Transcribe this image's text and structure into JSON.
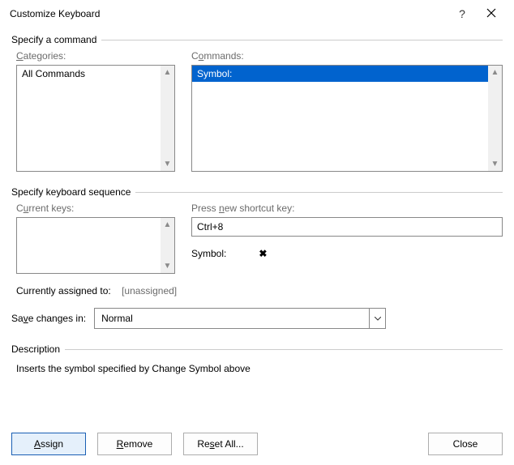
{
  "title": "Customize Keyboard",
  "sections": {
    "specify_command": "Specify a command",
    "specify_sequence": "Specify keyboard sequence",
    "description": "Description"
  },
  "categories": {
    "label": "Categories:",
    "label_access": "C",
    "selected": "All Commands"
  },
  "commands": {
    "label": "Commands:",
    "label_access": "o",
    "selected": "Symbol:"
  },
  "current_keys": {
    "label": "Current keys:",
    "label_access": "u"
  },
  "new_key": {
    "label": "Press new shortcut key:",
    "label_access": "n",
    "value": "Ctrl+8"
  },
  "symbol": {
    "label": "Symbol:",
    "glyph": "✖"
  },
  "assigned": {
    "label": "Currently assigned to:",
    "value": "[unassigned]"
  },
  "save": {
    "label": "Save changes in:",
    "label_access": "v",
    "value": "Normal"
  },
  "description_text": "Inserts the symbol specified by Change Symbol above",
  "buttons": {
    "assign": "Assign",
    "assign_access": "A",
    "remove": "Remove",
    "remove_access": "R",
    "reset": "Reset All...",
    "reset_access": "s",
    "close": "Close"
  }
}
